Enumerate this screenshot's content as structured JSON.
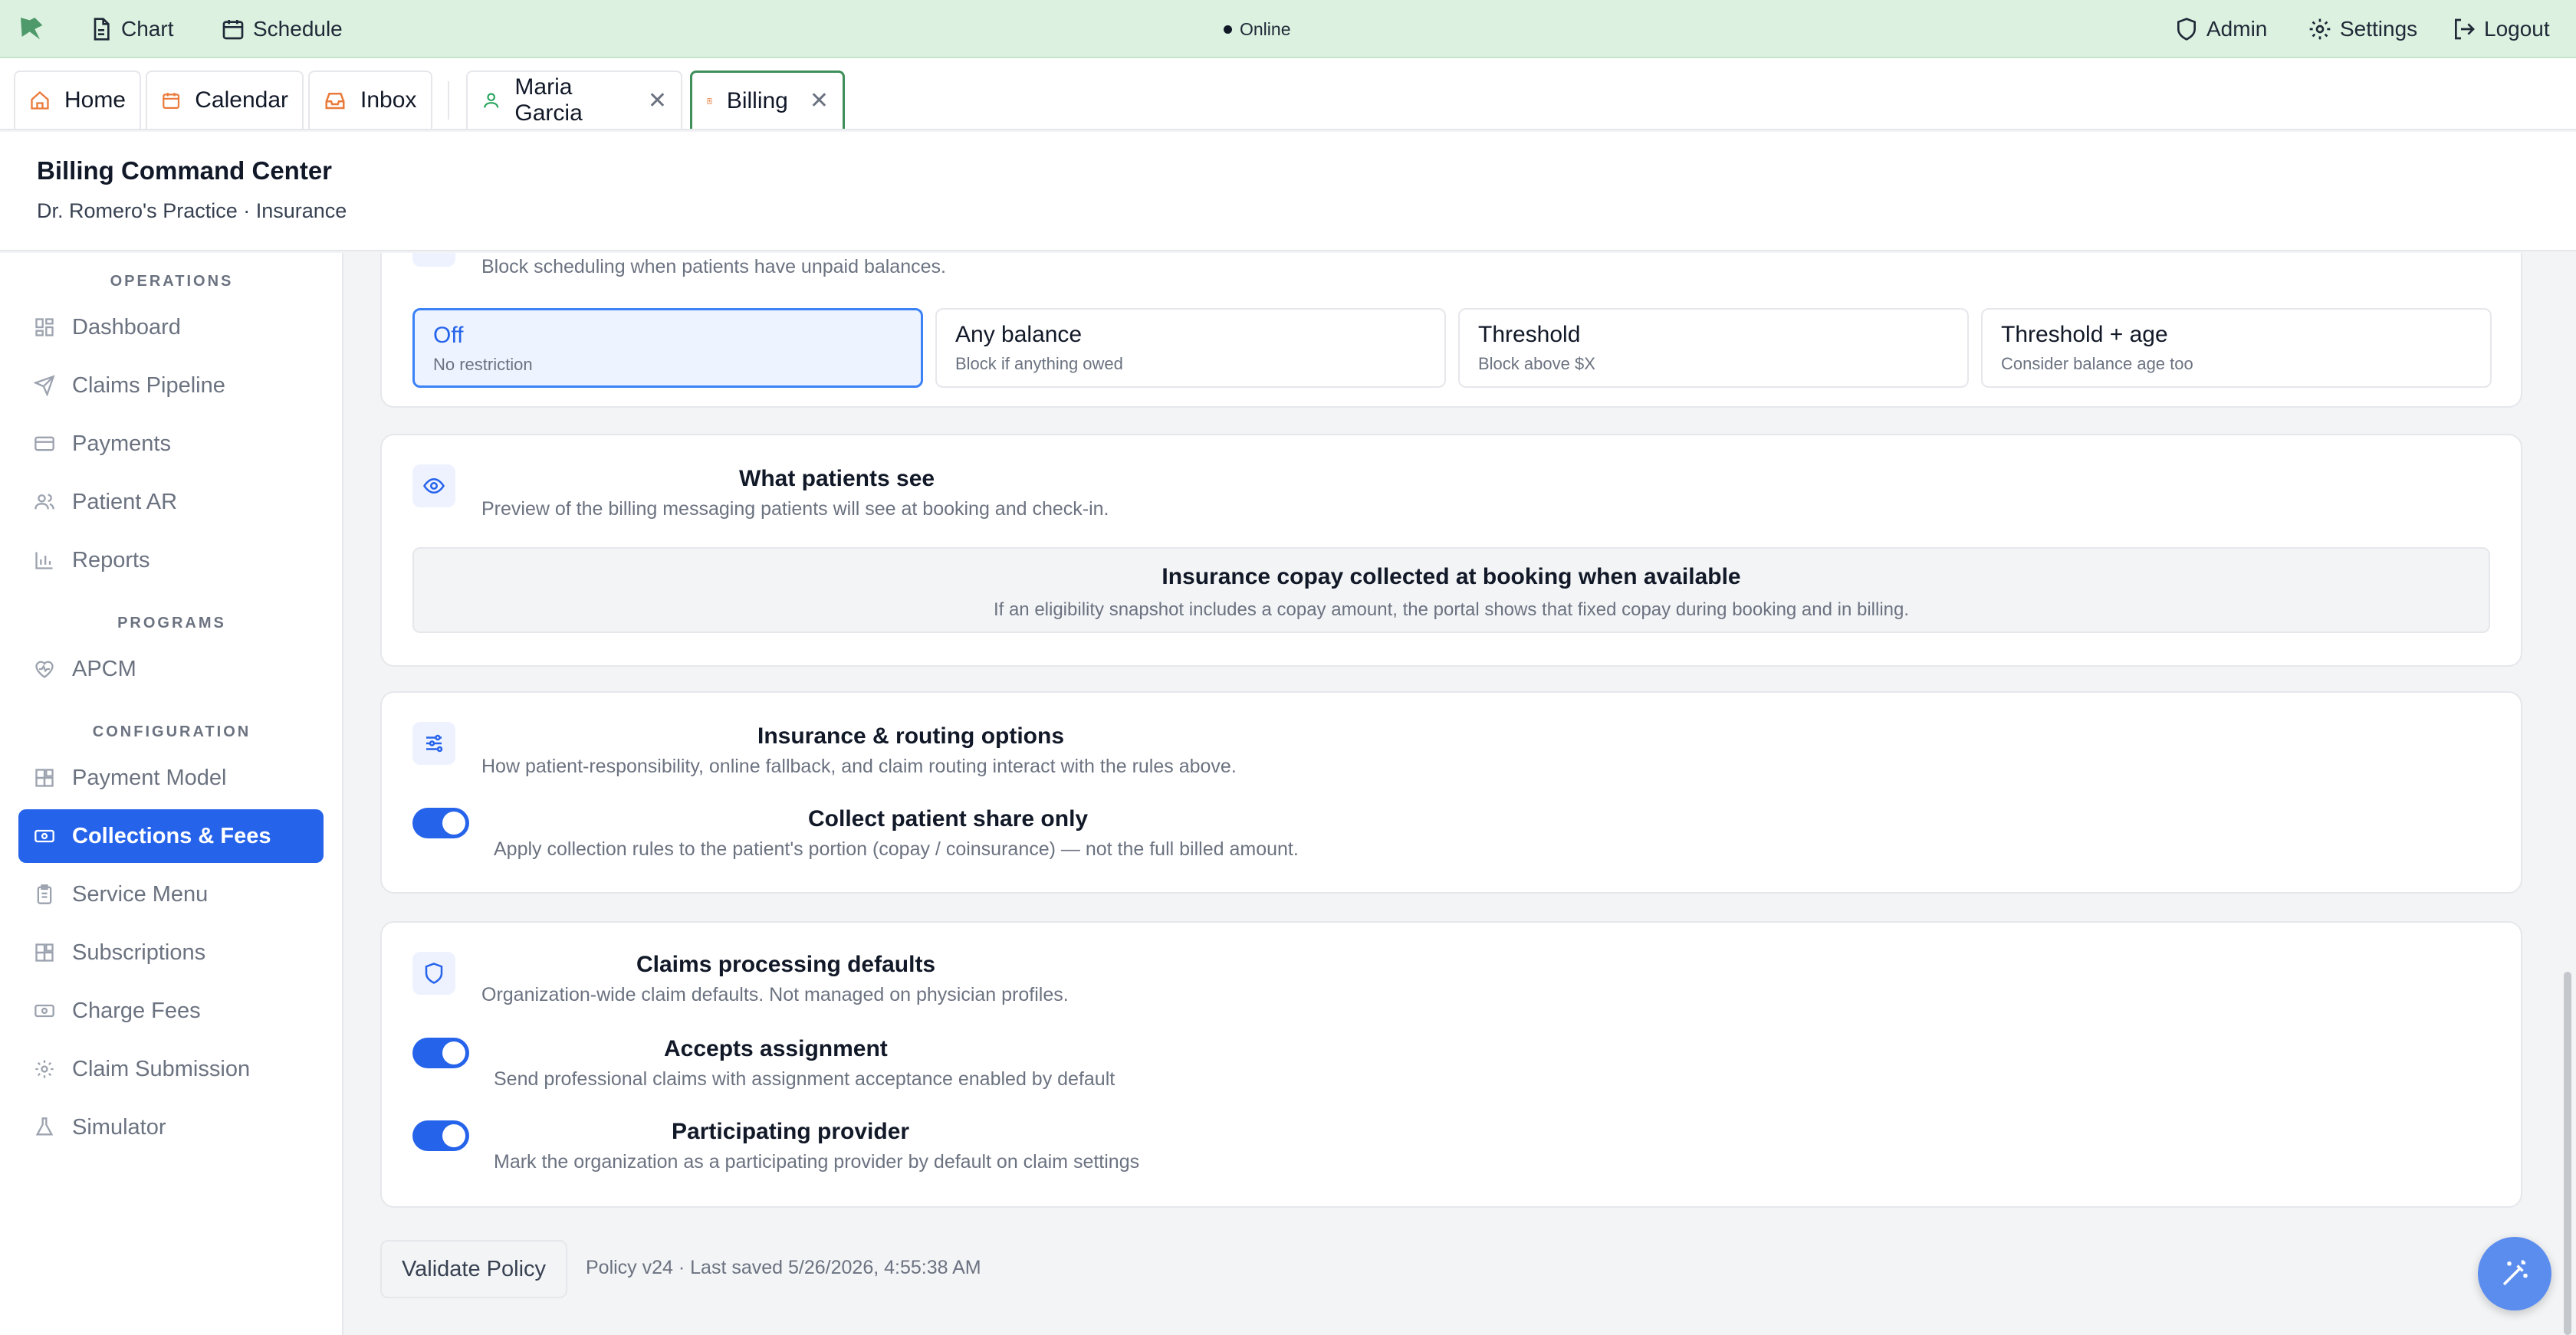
{
  "topbar": {
    "chart_label": "Chart",
    "schedule_label": "Schedule",
    "status": "Online",
    "admin_label": "Admin",
    "settings_label": "Settings",
    "logout_label": "Logout"
  },
  "tabs": [
    {
      "label": "Home"
    },
    {
      "label": "Calendar"
    },
    {
      "label": "Inbox"
    },
    {
      "label": "Maria Garcia"
    },
    {
      "label": "Billing"
    }
  ],
  "header": {
    "title": "Billing Command Center",
    "subtitle": "Dr. Romero's Practice · Insurance"
  },
  "sidebar": {
    "sections": [
      "OPERATIONS",
      "PROGRAMS",
      "CONFIGURATION"
    ],
    "items": [
      {
        "label": "Dashboard"
      },
      {
        "label": "Claims Pipeline"
      },
      {
        "label": "Payments"
      },
      {
        "label": "Patient AR"
      },
      {
        "label": "Reports"
      },
      {
        "label": "APCM"
      },
      {
        "label": "Payment Model"
      },
      {
        "label": "Collections & Fees"
      },
      {
        "label": "Service Menu"
      },
      {
        "label": "Subscriptions"
      },
      {
        "label": "Charge Fees"
      },
      {
        "label": "Claim Submission"
      },
      {
        "label": "Simulator"
      }
    ]
  },
  "scheduling": {
    "subtitle": "Block scheduling when patients have unpaid balances.",
    "options": [
      {
        "title": "Off",
        "sub": "No restriction",
        "selected": true
      },
      {
        "title": "Any balance",
        "sub": "Block if anything owed",
        "selected": false
      },
      {
        "title": "Threshold",
        "sub": "Block above $X",
        "selected": false
      },
      {
        "title": "Threshold + age",
        "sub": "Consider balance age too",
        "selected": false
      }
    ]
  },
  "preview": {
    "title": "What patients see",
    "subtitle": "Preview of the billing messaging patients will see at booking and check-in.",
    "box_title": "Insurance copay collected at booking when available",
    "box_text": "If an eligibility snapshot includes a copay amount, the portal shows that fixed copay during booking and in billing."
  },
  "routing": {
    "title": "Insurance & routing options",
    "subtitle": "How patient-responsibility, online fallback, and claim routing interact with the rules above.",
    "toggle_title": "Collect patient share only",
    "toggle_sub": "Apply collection rules to the patient's portion (copay / coinsurance) — not the full billed amount.",
    "toggle_on": true
  },
  "claims": {
    "title": "Claims processing defaults",
    "subtitle": "Organization-wide claim defaults. Not managed on physician profiles.",
    "toggles": [
      {
        "title": "Accepts assignment",
        "sub": "Send professional claims with assignment acceptance enabled by default",
        "on": true
      },
      {
        "title": "Participating provider",
        "sub": "Mark the organization as a participating provider by default on claim settings",
        "on": true
      }
    ]
  },
  "footer": {
    "validate_label": "Validate Policy",
    "saved_text": "Policy v24 · Last saved 5/26/2026, 4:55:38 AM"
  },
  "colors": {
    "accent": "#2563eb",
    "topbar": "#dcf1e0",
    "active_tab_border": "#3f8f5a"
  }
}
